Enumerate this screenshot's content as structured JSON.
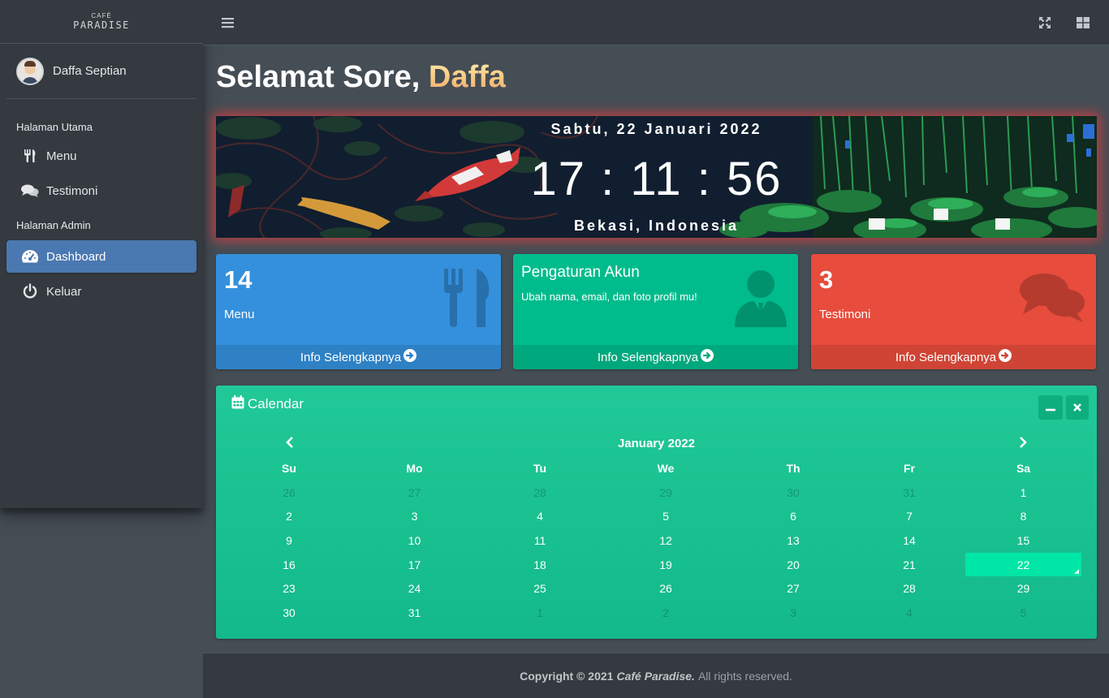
{
  "brand": {
    "top": "CAFÉ",
    "main": "PARADISE"
  },
  "user": {
    "name": "Daffa Septian"
  },
  "sidebar": {
    "headers": [
      "Halaman Utama",
      "Halaman Admin"
    ],
    "items": [
      {
        "label": "Menu",
        "icon": "utensils-icon"
      },
      {
        "label": "Testimoni",
        "icon": "comments-icon"
      },
      {
        "label": "Dashboard",
        "icon": "tachometer-icon",
        "active": true
      },
      {
        "label": "Keluar",
        "icon": "power-icon"
      }
    ]
  },
  "topbar": {
    "icons": [
      "hamburger-icon",
      "fullscreen-icon",
      "grid-icon"
    ]
  },
  "greeting": {
    "prefix": "Selamat Sore,",
    "name": "Daffa"
  },
  "banner": {
    "date": "Sabtu, 22 Januari 2022",
    "time": "17 : 11 : 56",
    "location": "Bekasi, Indonesia"
  },
  "boxes": [
    {
      "number": "14",
      "label": "Menu",
      "footer": "Info Selengkapnya",
      "color": "#3490dc",
      "icon": "utensils-icon"
    },
    {
      "title": "Pengaturan Akun",
      "subtitle": "Ubah nama, email, dan foto profil mu!",
      "footer": "Info Selengkapnya",
      "color": "#00bc8c",
      "icon": "user-tie-icon"
    },
    {
      "number": "3",
      "label": "Testimoni",
      "footer": "Info Selengkapnya",
      "color": "#e74c3c",
      "icon": "comments-icon"
    }
  ],
  "calendar": {
    "title": "Calendar",
    "month": "January 2022",
    "weekdays": [
      "Su",
      "Mo",
      "Tu",
      "We",
      "Th",
      "Fr",
      "Sa"
    ],
    "weeks": [
      [
        "26",
        "27",
        "28",
        "29",
        "30",
        "31",
        "1"
      ],
      [
        "2",
        "3",
        "4",
        "5",
        "6",
        "7",
        "8"
      ],
      [
        "9",
        "10",
        "11",
        "12",
        "13",
        "14",
        "15"
      ],
      [
        "16",
        "17",
        "18",
        "19",
        "20",
        "21",
        "22"
      ],
      [
        "23",
        "24",
        "25",
        "26",
        "27",
        "28",
        "29"
      ],
      [
        "30",
        "31",
        "1",
        "2",
        "3",
        "4",
        "5"
      ]
    ],
    "today": "22",
    "colors": {
      "card": "#20c997",
      "today": "#00e6a6"
    }
  },
  "footer": {
    "copyright": "Copyright © 2021",
    "brand": "Café Paradise.",
    "rights": "All rights reserved."
  },
  "colors": {
    "sidebar": "#343a40",
    "active": "#4a78b0",
    "content": "#454d55"
  }
}
